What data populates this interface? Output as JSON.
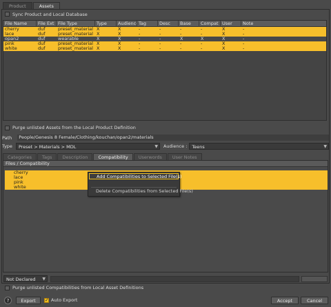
{
  "top_tabs": [
    "Product",
    "Assets"
  ],
  "sync_label": "Sync Product and Local Database",
  "asset_columns": [
    "File Name",
    "File Ext",
    "File Type",
    "Type",
    "Audience",
    "Tag",
    "Desc",
    "Base",
    "Compat",
    "User",
    "Note"
  ],
  "asset_rows": [
    {
      "cells": [
        "cherry",
        "duf",
        "preset_material",
        "X",
        "X",
        "-",
        "-",
        "-",
        "-",
        "X",
        "-"
      ],
      "selected": true
    },
    {
      "cells": [
        "lace",
        "duf",
        "preset_material",
        "X",
        "X",
        "-",
        "-",
        "-",
        "-",
        "X",
        "-"
      ],
      "selected": true
    },
    {
      "cells": [
        "opan2",
        "duf",
        "wearable",
        "X",
        "X",
        "-",
        "-",
        "X",
        "X",
        "X",
        "-"
      ],
      "selected": false
    },
    {
      "cells": [
        "pink",
        "duf",
        "preset_material",
        "X",
        "X",
        "-",
        "-",
        "-",
        "-",
        "X",
        "-"
      ],
      "selected": true
    },
    {
      "cells": [
        "white",
        "duf",
        "preset_material",
        "X",
        "X",
        "-",
        "-",
        "-",
        "-",
        "X",
        "-"
      ],
      "selected": true
    }
  ],
  "purge_local_label": "Purge unlisted Assets from the Local Product Definition",
  "path_label": "Path",
  "path_value": "People/Genesis 8 Female/Clothing/kouchan/opan2/materials",
  "type_label": "Type",
  "type_value": "Preset > Materials > MDL",
  "audience_label": "Audience :",
  "audience_value": "Teens",
  "sub_tabs": [
    {
      "label": "Categories",
      "active": false
    },
    {
      "label": "Tags",
      "active": false
    },
    {
      "label": "Description",
      "active": false
    },
    {
      "label": "Compatibility",
      "active": true
    },
    {
      "label": "Userwords",
      "active": false
    },
    {
      "label": "User Notes",
      "active": false
    }
  ],
  "compat_header": "Files / Compatibility",
  "compat_items": [
    "cherry",
    "lace",
    "pink",
    "white"
  ],
  "context_menu": {
    "add": "Add Compatibilities to Selected File(s)",
    "delete": "Delete Compatibilities from Selected File(s)"
  },
  "not_declared_value": "Not Declared",
  "purge_compat_label": "Purge unlisted Compatibilities from Local Asset Definitions",
  "help_label": "?",
  "export_label": "Export",
  "auto_export_label": "Auto Export",
  "accept_label": "Accept",
  "cancel_label": "Cancel",
  "colors": {
    "selection": "#f7bf2b",
    "background": "#4a4a4a",
    "accent": "#f0c020"
  }
}
